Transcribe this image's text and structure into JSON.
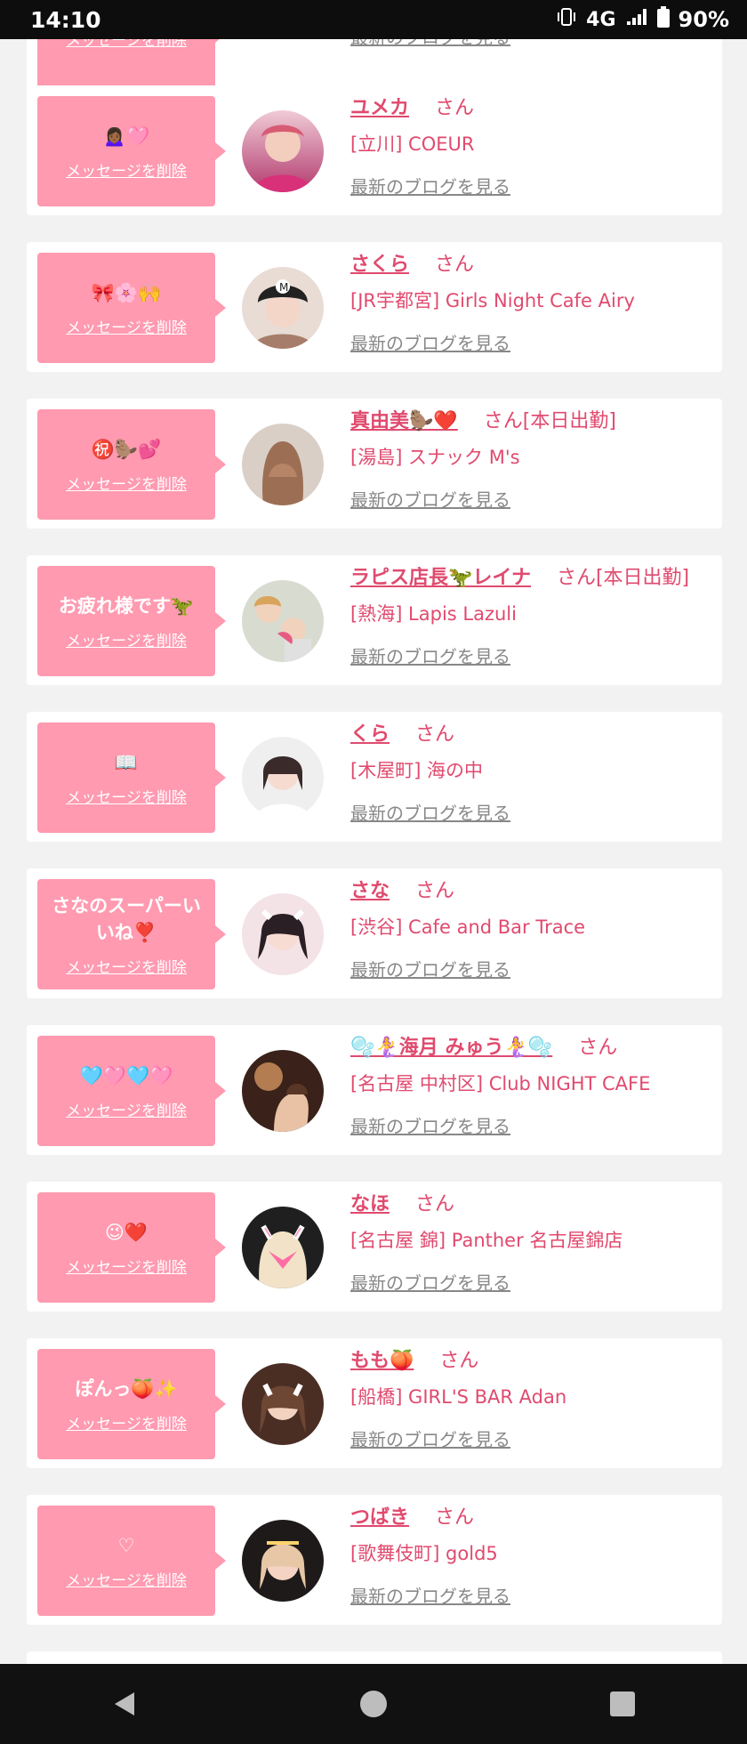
{
  "status": {
    "time": "14:10",
    "network": "4G",
    "battery": "90%"
  },
  "delete_label": "メッセージを削除",
  "blog_label": "最新のブログを見る",
  "cards": [
    {
      "message": "",
      "name": "",
      "san": "",
      "shop": ""
    },
    {
      "message": "🙍🏾‍♀️🩷",
      "name": "ユメカ",
      "san": "さん",
      "shop": "[立川] COEUR"
    },
    {
      "message": "🎀🌸🙌",
      "name": "さくら",
      "san": "さん",
      "shop": "[JR宇都宮] Girls Night Cafe Airy"
    },
    {
      "message": "㊗️🦫💕",
      "name": "真由美🦫❤️",
      "san": "さん[本日出勤]",
      "shop": "[湯島] スナック M's"
    },
    {
      "message": "お疲れ様です🦖",
      "name": "ラピス店長🦖レイナ",
      "san": "さん[本日出勤]",
      "shop": "[熱海] Lapis Lazuli"
    },
    {
      "message": "📖",
      "name": "くら",
      "san": "さん",
      "shop": "[木屋町] 海の中"
    },
    {
      "message": "さなのスーパーいいね❣️",
      "name": "さな",
      "san": "さん",
      "shop": "[渋谷] Cafe and Bar Trace"
    },
    {
      "message": "🩵🩷🩵🩷",
      "name": "🫧🧜‍♀️海月 みゅう🧜‍♀️🫧",
      "san": "さん",
      "shop": "[名古屋 中村区] Club NIGHT CAFE"
    },
    {
      "message": "😉❤️",
      "name": "なほ",
      "san": "さん",
      "shop": "[名古屋 錦] Panther 名古屋錦店"
    },
    {
      "message": "ぽんっ🍑✨",
      "name": "もも🍑",
      "san": "さん",
      "shop": "[船橋] GIRL'S BAR Adan"
    },
    {
      "message": "♡",
      "name": "つばき",
      "san": "さん",
      "shop": "[歌舞伎町] gold5"
    }
  ]
}
